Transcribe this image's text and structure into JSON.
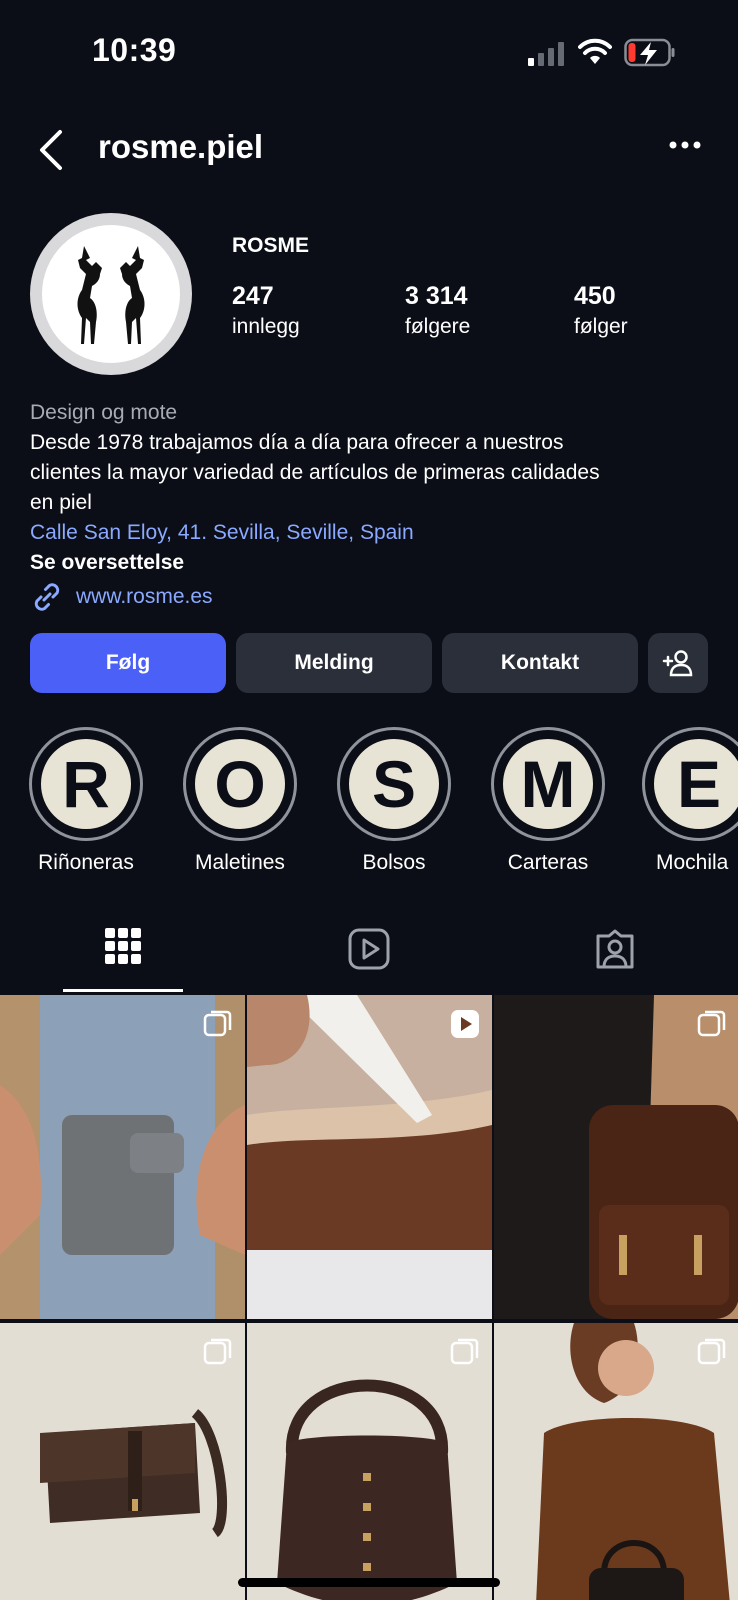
{
  "status_bar": {
    "time": "10:39"
  },
  "header": {
    "username": "rosme.piel"
  },
  "profile": {
    "display_name": "ROSME",
    "stats": [
      {
        "value": "247",
        "label": "innlegg"
      },
      {
        "value": "3 314",
        "label": "følgere"
      },
      {
        "value": "450",
        "label": "følger"
      }
    ],
    "category": "Design og mote",
    "bio_line1": "Desde 1978 trabajamos día a día para ofrecer a nuestros",
    "bio_line2": "clientes la mayor variedad de artículos de primeras calidades",
    "bio_line3": "en piel",
    "location": "Calle San Eloy, 41. Sevilla, Seville, Spain",
    "translate": "Se oversettelse",
    "website": "www.rosme.es"
  },
  "actions": {
    "follow": "Følg",
    "message": "Melding",
    "contact": "Kontakt"
  },
  "highlights": [
    {
      "letter": "R",
      "label": "Riñoneras"
    },
    {
      "letter": "O",
      "label": "Maletines"
    },
    {
      "letter": "S",
      "label": "Bolsos"
    },
    {
      "letter": "M",
      "label": "Carteras"
    },
    {
      "letter": "E",
      "label": "Mochila"
    }
  ],
  "tabs": [
    "grid-icon",
    "reels-icon",
    "tagged-icon"
  ],
  "colors": {
    "accent": "#4a60f7",
    "link": "#8aa9ff",
    "background": "#0b0e17",
    "button": "#2a2f3a"
  }
}
